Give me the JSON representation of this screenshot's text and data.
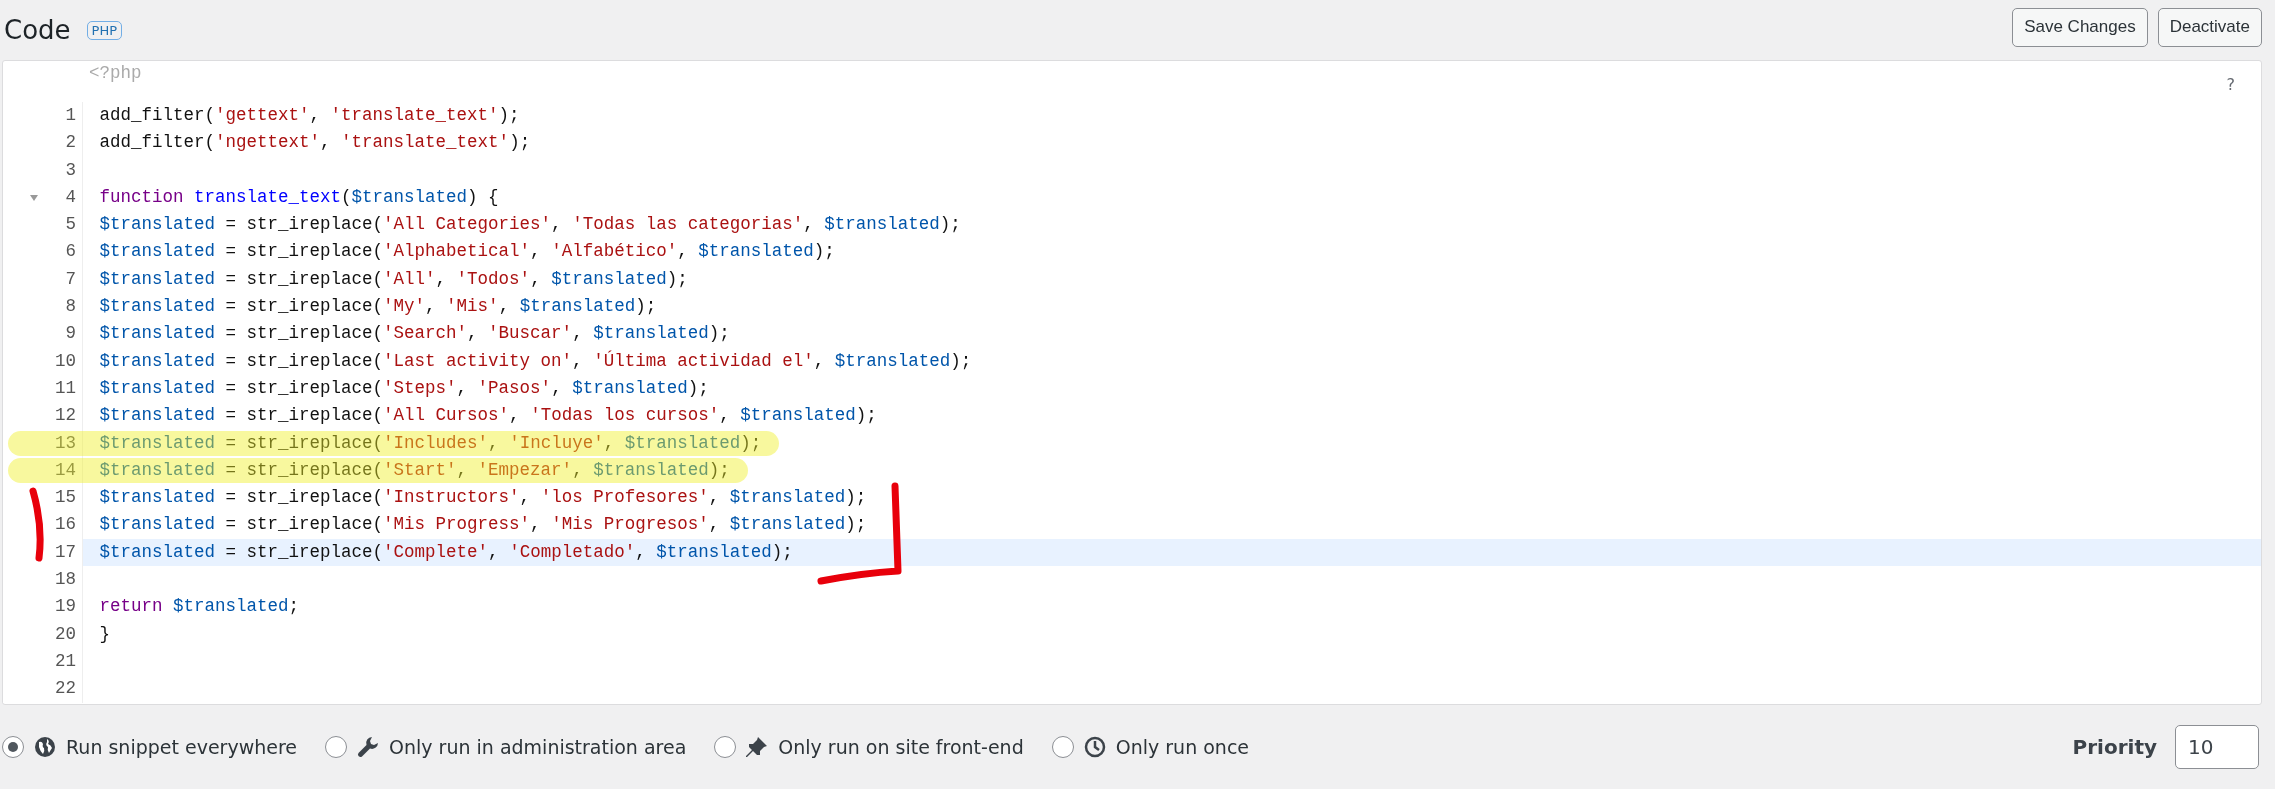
{
  "header": {
    "title": "Code",
    "badge": "PHP",
    "buttons": [
      "Save Changes",
      "Deactivate"
    ]
  },
  "editor": {
    "opening_tag": "<?php",
    "help": "?",
    "lines": [
      {
        "number": "1",
        "tokens": [
          {
            "kind": "plain",
            "text": "add_filter("
          },
          {
            "kind": "string",
            "text": "'gettext'"
          },
          {
            "kind": "plain",
            "text": ", "
          },
          {
            "kind": "string",
            "text": "'translate_text'"
          },
          {
            "kind": "plain",
            "text": ");"
          }
        ]
      },
      {
        "number": "2",
        "tokens": [
          {
            "kind": "plain",
            "text": "add_filter("
          },
          {
            "kind": "string",
            "text": "'ngettext'"
          },
          {
            "kind": "plain",
            "text": ", "
          },
          {
            "kind": "string",
            "text": "'translate_text'"
          },
          {
            "kind": "plain",
            "text": ");"
          }
        ]
      },
      {
        "number": "3"
      },
      {
        "number": "4",
        "foldable": true,
        "tokens": [
          {
            "kind": "keyword",
            "text": "function"
          },
          {
            "kind": "def",
            "text": "translate_text"
          },
          {
            "kind": "plain",
            "text": "("
          },
          {
            "kind": "variable",
            "text": "$translated"
          },
          {
            "kind": "plain",
            "text": ") {"
          }
        ]
      },
      {
        "number": "5",
        "tokens": [
          {
            "kind": "variable",
            "text": "$translated"
          },
          {
            "kind": "plain",
            "text": " = str_ireplace("
          },
          {
            "kind": "string",
            "text": "'All Categories'"
          },
          {
            "kind": "plain",
            "text": ", "
          },
          {
            "kind": "string",
            "text": "'Todas las categorias'"
          },
          {
            "kind": "plain",
            "text": ", "
          },
          {
            "kind": "variable",
            "text": "$translated"
          },
          {
            "kind": "plain",
            "text": ");"
          }
        ]
      },
      {
        "number": "6",
        "tokens": [
          {
            "kind": "variable",
            "text": "$translated"
          },
          {
            "kind": "plain",
            "text": " = str_ireplace("
          },
          {
            "kind": "string",
            "text": "'Alphabetical'"
          },
          {
            "kind": "plain",
            "text": ", "
          },
          {
            "kind": "string",
            "text": "'Alfabético'"
          },
          {
            "kind": "plain",
            "text": ", "
          },
          {
            "kind": "variable",
            "text": "$translated"
          },
          {
            "kind": "plain",
            "text": ");"
          }
        ]
      },
      {
        "number": "7",
        "tokens": [
          {
            "kind": "variable",
            "text": "$translated"
          },
          {
            "kind": "plain",
            "text": " = str_ireplace("
          },
          {
            "kind": "string",
            "text": "'All'"
          },
          {
            "kind": "plain",
            "text": ", "
          },
          {
            "kind": "string",
            "text": "'Todos'"
          },
          {
            "kind": "plain",
            "text": ", "
          },
          {
            "kind": "variable",
            "text": "$translated"
          },
          {
            "kind": "plain",
            "text": ");"
          }
        ]
      },
      {
        "number": "8",
        "tokens": [
          {
            "kind": "variable",
            "text": "$translated"
          },
          {
            "kind": "plain",
            "text": " = str_ireplace("
          },
          {
            "kind": "string",
            "text": "'My'"
          },
          {
            "kind": "plain",
            "text": ", "
          },
          {
            "kind": "string",
            "text": "'Mis'"
          },
          {
            "kind": "plain",
            "text": ", "
          },
          {
            "kind": "variable",
            "text": "$translated"
          },
          {
            "kind": "plain",
            "text": ");"
          }
        ]
      },
      {
        "number": "9",
        "tokens": [
          {
            "kind": "variable",
            "text": "$translated"
          },
          {
            "kind": "plain",
            "text": " = str_ireplace("
          },
          {
            "kind": "string",
            "text": "'Search'"
          },
          {
            "kind": "plain",
            "text": ", "
          },
          {
            "kind": "string",
            "text": "'Buscar'"
          },
          {
            "kind": "plain",
            "text": ", "
          },
          {
            "kind": "variable",
            "text": "$translated"
          },
          {
            "kind": "plain",
            "text": ");"
          }
        ]
      },
      {
        "number": "10",
        "tokens": [
          {
            "kind": "variable",
            "text": "$translated"
          },
          {
            "kind": "plain",
            "text": " = str_ireplace("
          },
          {
            "kind": "string",
            "text": "'Last activity on'"
          },
          {
            "kind": "plain",
            "text": ", "
          },
          {
            "kind": "string",
            "text": "'Última actividad el'"
          },
          {
            "kind": "plain",
            "text": ", "
          },
          {
            "kind": "variable",
            "text": "$translated"
          },
          {
            "kind": "plain",
            "text": ");"
          }
        ]
      },
      {
        "number": "11",
        "tokens": [
          {
            "kind": "variable",
            "text": "$translated"
          },
          {
            "kind": "plain",
            "text": " = str_ireplace("
          },
          {
            "kind": "string",
            "text": "'Steps'"
          },
          {
            "kind": "plain",
            "text": ", "
          },
          {
            "kind": "string",
            "text": "'Pasos'"
          },
          {
            "kind": "plain",
            "text": ", "
          },
          {
            "kind": "variable",
            "text": "$translated"
          },
          {
            "kind": "plain",
            "text": ");"
          }
        ]
      },
      {
        "number": "12",
        "tokens": [
          {
            "kind": "variable",
            "text": "$translated"
          },
          {
            "kind": "plain",
            "text": " = str_ireplace("
          },
          {
            "kind": "string",
            "text": "'All Cursos'"
          },
          {
            "kind": "plain",
            "text": ", "
          },
          {
            "kind": "string",
            "text": "'Todas los cursos'"
          },
          {
            "kind": "plain",
            "text": ", "
          },
          {
            "kind": "variable",
            "text": "$translated"
          },
          {
            "kind": "plain",
            "text": ");"
          }
        ]
      },
      {
        "number": "13",
        "highlighted": true,
        "tokens": [
          {
            "kind": "variable",
            "text": "$translated"
          },
          {
            "kind": "plain",
            "text": " = str_ireplace("
          },
          {
            "kind": "string",
            "text": "'Includes'"
          },
          {
            "kind": "plain",
            "text": ", "
          },
          {
            "kind": "string",
            "text": "'Incluye'"
          },
          {
            "kind": "plain",
            "text": ", "
          },
          {
            "kind": "variable",
            "text": "$translated"
          },
          {
            "kind": "plain",
            "text": ");"
          }
        ]
      },
      {
        "number": "14",
        "highlighted": true,
        "tokens": [
          {
            "kind": "variable",
            "text": "$translated"
          },
          {
            "kind": "plain",
            "text": " = str_ireplace("
          },
          {
            "kind": "string",
            "text": "'Start'"
          },
          {
            "kind": "plain",
            "text": ", "
          },
          {
            "kind": "string",
            "text": "'Empezar'"
          },
          {
            "kind": "plain",
            "text": ", "
          },
          {
            "kind": "variable",
            "text": "$translated"
          },
          {
            "kind": "plain",
            "text": ");"
          }
        ]
      },
      {
        "number": "15",
        "tokens": [
          {
            "kind": "variable",
            "text": "$translated"
          },
          {
            "kind": "plain",
            "text": " = str_ireplace("
          },
          {
            "kind": "string",
            "text": "'Instructors'"
          },
          {
            "kind": "plain",
            "text": ", "
          },
          {
            "kind": "string",
            "text": "'los Profesores'"
          },
          {
            "kind": "plain",
            "text": ", "
          },
          {
            "kind": "variable",
            "text": "$translated"
          },
          {
            "kind": "plain",
            "text": ");"
          }
        ]
      },
      {
        "number": "16",
        "tokens": [
          {
            "kind": "variable",
            "text": "$translated"
          },
          {
            "kind": "plain",
            "text": " = str_ireplace("
          },
          {
            "kind": "string",
            "text": "'Mis Progress'"
          },
          {
            "kind": "plain",
            "text": ", "
          },
          {
            "kind": "string",
            "text": "'Mis Progresos'"
          },
          {
            "kind": "plain",
            "text": ", "
          },
          {
            "kind": "variable",
            "text": "$translated"
          },
          {
            "kind": "plain",
            "text": ");"
          }
        ]
      },
      {
        "number": "17",
        "active": true,
        "tokens": [
          {
            "kind": "variable",
            "text": "$translated"
          },
          {
            "kind": "plain",
            "text": " = str_ireplace("
          },
          {
            "kind": "string",
            "text": "'Complete'"
          },
          {
            "kind": "plain",
            "text": ", "
          },
          {
            "kind": "string",
            "text": "'Completado'"
          },
          {
            "kind": "plain",
            "text": ", "
          },
          {
            "kind": "variable",
            "text": "$translated"
          },
          {
            "kind": "plain",
            "text": ");"
          }
        ]
      },
      {
        "number": "18"
      },
      {
        "number": "19",
        "tokens": [
          {
            "kind": "keyword",
            "text": "return"
          },
          {
            "kind": "variable",
            "text": "$translated"
          },
          {
            "kind": "plain",
            "text": ";"
          }
        ]
      },
      {
        "number": "20",
        "tokens": [
          {
            "kind": "plain",
            "text": "}"
          }
        ]
      },
      {
        "number": "21"
      },
      {
        "number": "22"
      }
    ]
  },
  "scope_options": [
    {
      "label": "Run snippet everywhere",
      "kind": "everywhere",
      "selected": true
    },
    {
      "label": "Only run in administration area",
      "kind": "admin",
      "selected": false
    },
    {
      "label": "Only run on site front-end",
      "kind": "frontend",
      "selected": false
    },
    {
      "label": "Only run once",
      "kind": "once",
      "selected": false
    }
  ],
  "priority": {
    "label": "Priority",
    "value": "10"
  }
}
